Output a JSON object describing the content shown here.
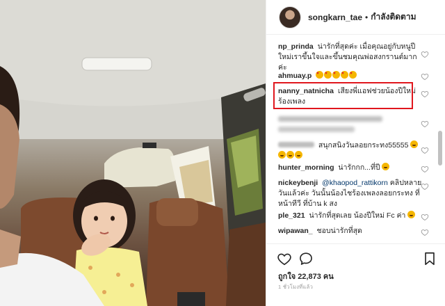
{
  "header": {
    "username": "songkarn_tae",
    "separator": "•",
    "follow_status": "กำลังติดตาม"
  },
  "comments": [
    {
      "user": "np_prinda",
      "text": "น่ารักที่สุดค่ะ เมื่อคุณอยู่กับหนูปีใหม่เราขึ้นใจและขึ้นชมคุณพ่อสงกรานต์มากค่ะ",
      "blurred": false
    },
    {
      "user": "ahmuay.p",
      "text": "",
      "emojis": [
        "love",
        "love",
        "love",
        "love",
        "love"
      ],
      "blurred": false
    },
    {
      "user": "nanny_natnicha",
      "text": "เสียงพี่แอฟช่วยน้องปีใหม่ร้องเพลง",
      "blurred": false,
      "highlighted": true
    },
    {
      "user": "",
      "text": "",
      "blurred": true
    },
    {
      "user": "",
      "text": "สนุกสนิงวันลอยกระทง55555",
      "emojis": [
        "laugh",
        "laugh",
        "laugh",
        "laugh"
      ],
      "blurred_user": true
    },
    {
      "user": "hunter_morning",
      "text": "น่ารักกก...ที่ปี",
      "emojis": [
        "laugh"
      ],
      "blurred": false
    },
    {
      "user": "nickeybenji",
      "mention": "@khaopod_rattikorn",
      "text": "คลิปหลายวันแล้วค่ะ วันนั้นน้องไชร้องเพลงลอยกระทง ที่หน้าทีวี ที่บ้าน k สง",
      "blurred": false
    },
    {
      "user": "ple_321",
      "text": "น่ารักที่สุดเลย น้องปีใหม่ Fc ค่า",
      "emojis": [
        "laugh"
      ],
      "blurred": false
    },
    {
      "user": "wipawan_",
      "text": "ชอบน่ารักที่สุด",
      "blurred": false
    }
  ],
  "likes_text": "ถูกใจ 22,873 คน",
  "time_ago": "1 ชั่วโมงที่แล้ว",
  "icons": [
    "heart-icon",
    "comment-icon",
    "bookmark-icon"
  ],
  "colors": {
    "highlight": "#e0161d",
    "text": "#262626",
    "muted": "#999999"
  }
}
